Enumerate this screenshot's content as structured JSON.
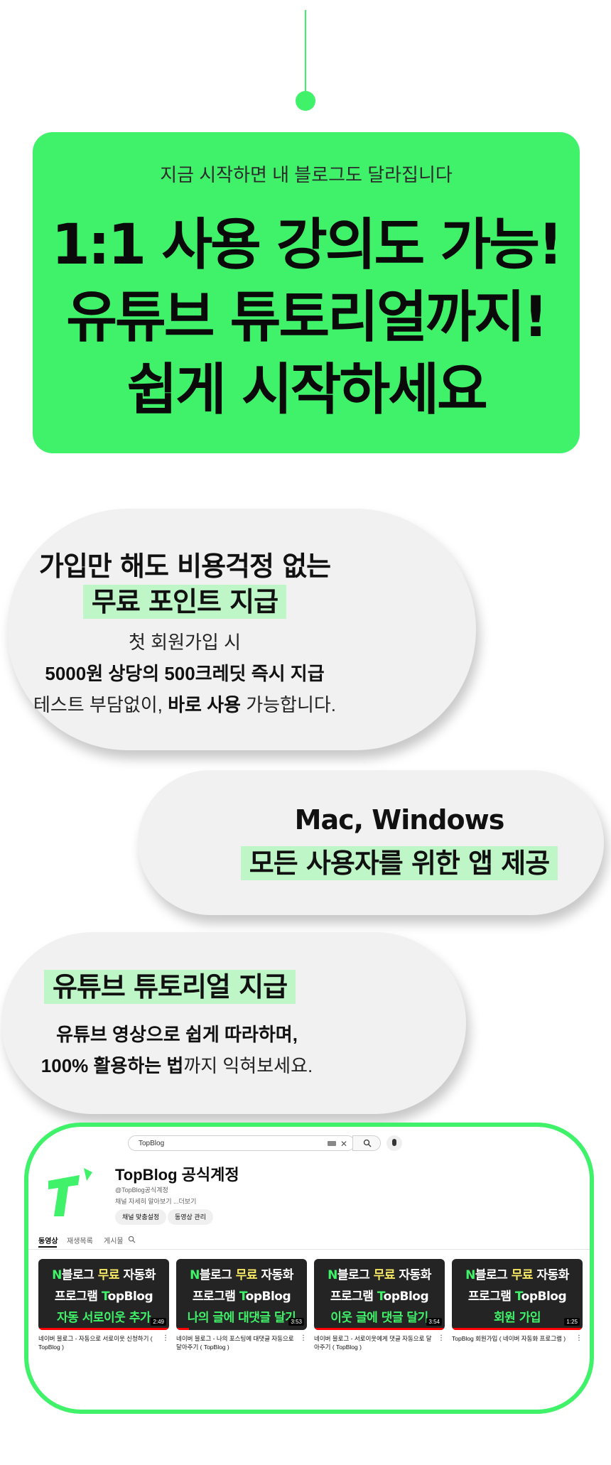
{
  "hero": {
    "subtitle": "지금 시작하면 내 블로그도 달라집니다",
    "title_lines": [
      "1:1 사용 강의도 가능!",
      "유튜브 튜토리얼까지!",
      "쉽게 시작하세요"
    ]
  },
  "colors": {
    "accent_green": "#3ff26a",
    "highlight_green": "#bef6c8",
    "bubble_bg": "#f1f1f1"
  },
  "bubble1": {
    "title": "가입만 해도 비용걱정 없는",
    "title_highlight": "무료 포인트 지급",
    "line1": "첫 회원가입 시",
    "line2": "5000원 상당의 500크레딧 즉시 지급",
    "line3_normal": "테스트 부담없이, ",
    "line3_bold": "바로 사용",
    "line3_end": " 가능합니다."
  },
  "bubble2": {
    "title": "Mac, Windows",
    "title_highlight": "모든 사용자를 위한 앱 제공"
  },
  "bubble3": {
    "title_highlight": "유튜브 튜토리얼 지급",
    "line1": "유튜브 영상으로 쉽게 따라하며,",
    "line2_bold": "100% 활용하는 법",
    "line2_end": "까지 익혀보세요."
  },
  "youtube": {
    "search_value": "TopBlog",
    "channel_name": "TopBlog 공식계정",
    "handle": "@TopBlog공식계정",
    "description": "채널 자세히 알아보기 ...더보기",
    "buttons": [
      "채널 맞춤설정",
      "동영상 관리"
    ],
    "tabs": [
      "동영상",
      "재생목록",
      "게시물"
    ],
    "icons": {
      "search": "search-icon",
      "mic": "mic-icon",
      "clear": "close-icon",
      "keyboard": "keyboard-icon",
      "logo": "topblog-logo-icon"
    },
    "videos": [
      {
        "thumb_n": "N",
        "thumb_l1": "블로그 ",
        "thumb_free": "무료",
        "thumb_l1_end": " 자동화",
        "thumb_l2_a": "프로그램 ",
        "thumb_l2_t": "T",
        "thumb_l2_b": "opBlog",
        "thumb_l3": "자동 서로이웃 추가",
        "duration": "2:49",
        "progress": 1.0,
        "title": "네이버 블로그 - 자동으로 서로이웃 신청하기 ( TopBlog )"
      },
      {
        "thumb_n": "N",
        "thumb_l1": "블로그 ",
        "thumb_free": "무료",
        "thumb_l1_end": " 자동화",
        "thumb_l2_a": "프로그램 ",
        "thumb_l2_t": "T",
        "thumb_l2_b": "opBlog",
        "thumb_l3": "나의 글에 대댓글 달기",
        "duration": "3:53",
        "progress": 0.1,
        "title": "네이버 블로그 - 나의 포스팅에 대댓글 자동으로 달아주기 ( TopBlog )"
      },
      {
        "thumb_n": "N",
        "thumb_l1": "블로그 ",
        "thumb_free": "무료",
        "thumb_l1_end": " 자동화",
        "thumb_l2_a": "프로그램 ",
        "thumb_l2_t": "T",
        "thumb_l2_b": "opBlog",
        "thumb_l3": "이웃 글에 댓글 달기",
        "duration": "3:54",
        "progress": 1.0,
        "title": "네이버 블로그 - 서로이웃에게 댓글 자동으로 달아주기 ( TopBlog )"
      },
      {
        "thumb_n": "N",
        "thumb_l1": "블로그 ",
        "thumb_free": "무료",
        "thumb_l1_end": " 자동화",
        "thumb_l2_a": "프로그램 ",
        "thumb_l2_t": "T",
        "thumb_l2_b": "opBlog",
        "thumb_l3": "회원 가입",
        "duration": "1:25",
        "progress": 1.0,
        "title": "TopBlog 회원가입 ( 네이버 자동화 프로그램 )"
      }
    ]
  }
}
